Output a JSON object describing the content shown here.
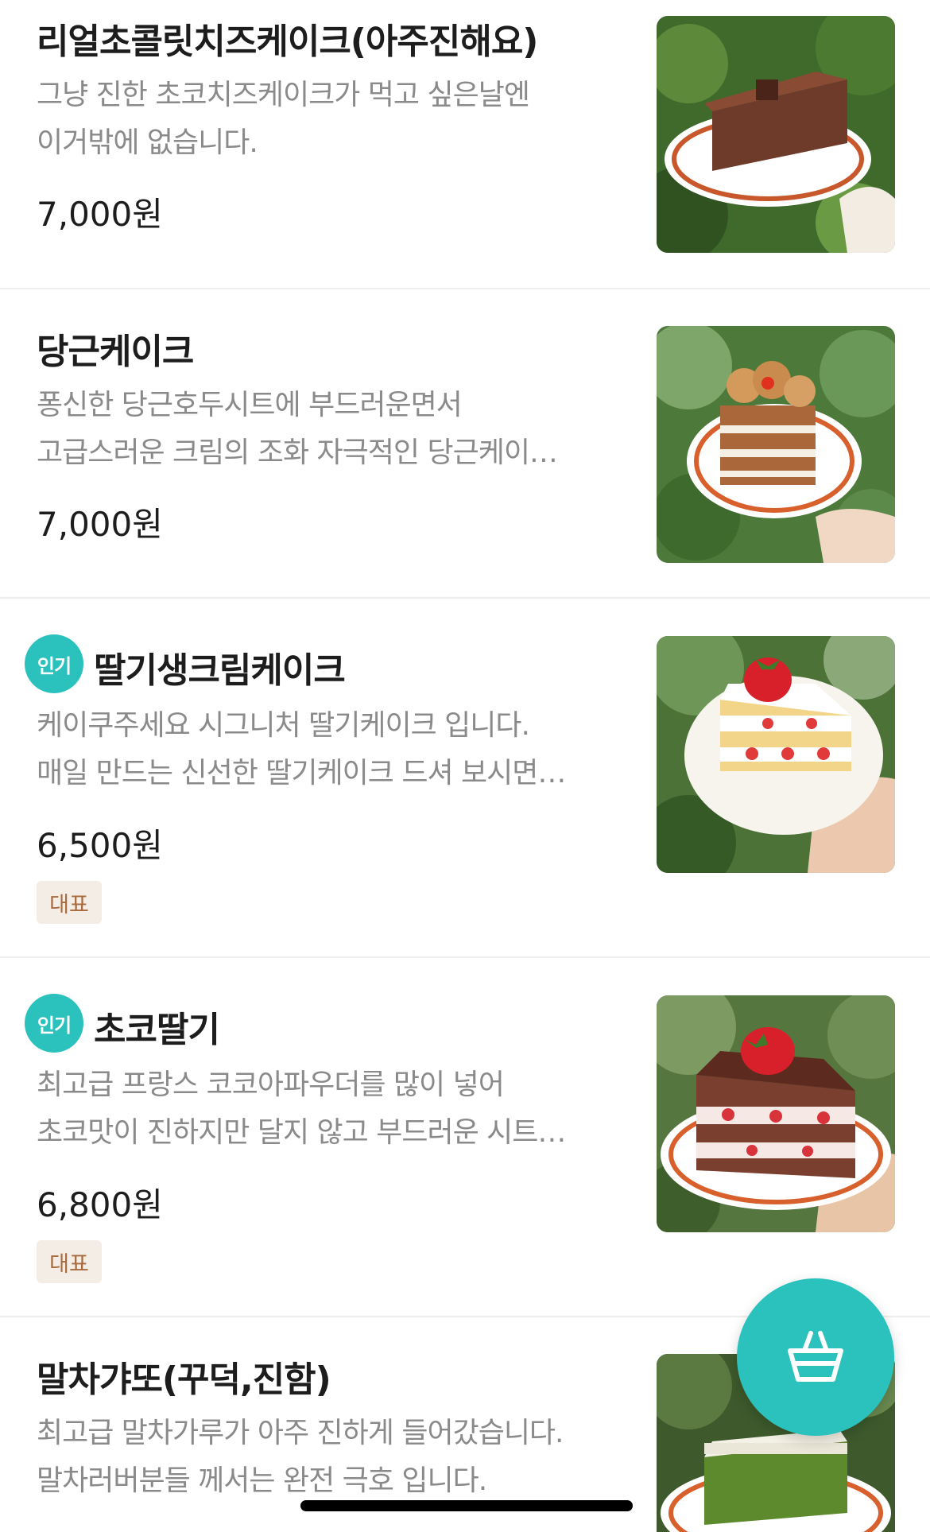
{
  "menu": {
    "items": [
      {
        "name": "리얼초콜릿치즈케이크(아주진해요)",
        "badge": "",
        "desc_line1": "그냥 진한 초코치즈케이크가 먹고 싶은날엔",
        "desc_line2": "이거밖에 없습니다.",
        "price": "7,000원",
        "tag": "",
        "image_icon": "chocolate-cheesecake-photo"
      },
      {
        "name": "당근케이크",
        "badge": "",
        "desc_line1": "퐁신한 당근호두시트에 부드러운면서",
        "desc_line2": "고급스러운 크림의 조화 자극적인 당근케이…",
        "price": "7,000원",
        "tag": "",
        "image_icon": "carrot-cake-photo"
      },
      {
        "name": "딸기생크림케이크",
        "badge": "인기",
        "desc_line1": "케이쿠주세요 시그니처 딸기케이크 입니다.",
        "desc_line2": "매일 만드는 신선한 딸기케이크 드셔 보시면…",
        "price": "6,500원",
        "tag": "대표",
        "image_icon": "strawberry-cream-cake-photo"
      },
      {
        "name": "초코딸기",
        "badge": "인기",
        "desc_line1": "최고급 프랑스 코코아파우더를 많이 넣어",
        "desc_line2": "초코맛이 진하지만 달지 않고 부드러운 시트…",
        "price": "6,800원",
        "tag": "대표",
        "image_icon": "choco-strawberry-cake-photo"
      },
      {
        "name": "말차갸또(꾸덕,진함)",
        "badge": "",
        "desc_line1": "최고급 말차가루가 아주 진하게 들어갔습니다.",
        "desc_line2": "말차러버분들 께서는 완전 극호 입니다.",
        "price": "",
        "tag": "",
        "image_icon": "matcha-gateau-photo"
      }
    ]
  },
  "cart": {
    "icon": "shopping-basket-icon"
  },
  "colors": {
    "accent": "#2bc1bc",
    "tag_bg": "#f3ede6",
    "tag_text": "#a86a3d",
    "desc_text": "#8a8a8a"
  }
}
